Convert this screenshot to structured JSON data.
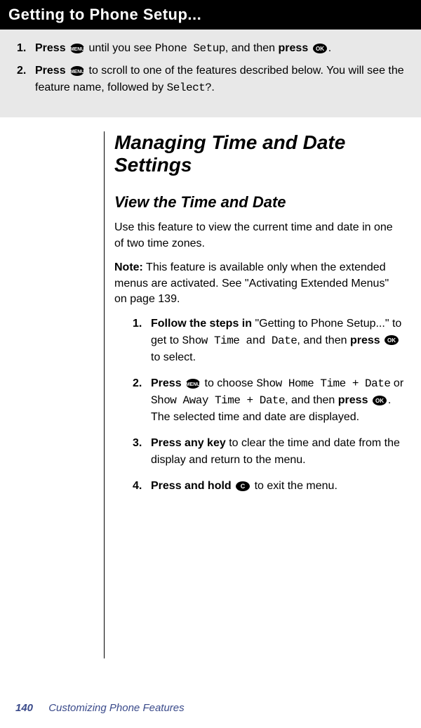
{
  "titleBar": "Getting to Phone Setup...",
  "setupSteps": {
    "s1": {
      "num": "1.",
      "pressWord": "Press",
      "text1": " until you see ",
      "mono1": "Phone Setup",
      "text2": ", and then ",
      "pressWord2": "press",
      "text3": "."
    },
    "s2": {
      "num": "2.",
      "pressWord": "Press",
      "text1": " to scroll to one of the features described below. You will see the feature name, followed by ",
      "mono1": "Select?",
      "text2": "."
    }
  },
  "sectionTitle": "Managing Time and Date Settings",
  "subsectionTitle": "View the Time and Date",
  "para1": "Use this feature to view the current time and date in one of two time zones.",
  "noteLabel": "Note:",
  "noteText": " This feature is available only when the extended menus are activated. See \"Activating Extended Menus\" on page 139.",
  "innerSteps": {
    "i1": {
      "num": "1.",
      "boldA": "Follow the steps in",
      "textA": " \"Getting to Phone Setup...\" to get to ",
      "monoA": "Show Time and Date",
      "textB": ", and then ",
      "boldB": "press",
      "textC": " to select."
    },
    "i2": {
      "num": "2.",
      "boldA": "Press",
      "textA": " to choose ",
      "monoA": "Show Home Time + Date",
      "textB": " or ",
      "monoB": "Show Away Time + Date",
      "textC": ", and then ",
      "boldB": "press",
      "textD": ". The selected time and date are displayed."
    },
    "i3": {
      "num": "3.",
      "boldA": "Press any key",
      "textA": " to clear the time and date from the display and return to the menu."
    },
    "i4": {
      "num": "4.",
      "boldA": "Press and hold",
      "textA": " to exit the menu."
    }
  },
  "footer": {
    "pageNum": "140",
    "chapter": "Customizing Phone Features"
  }
}
